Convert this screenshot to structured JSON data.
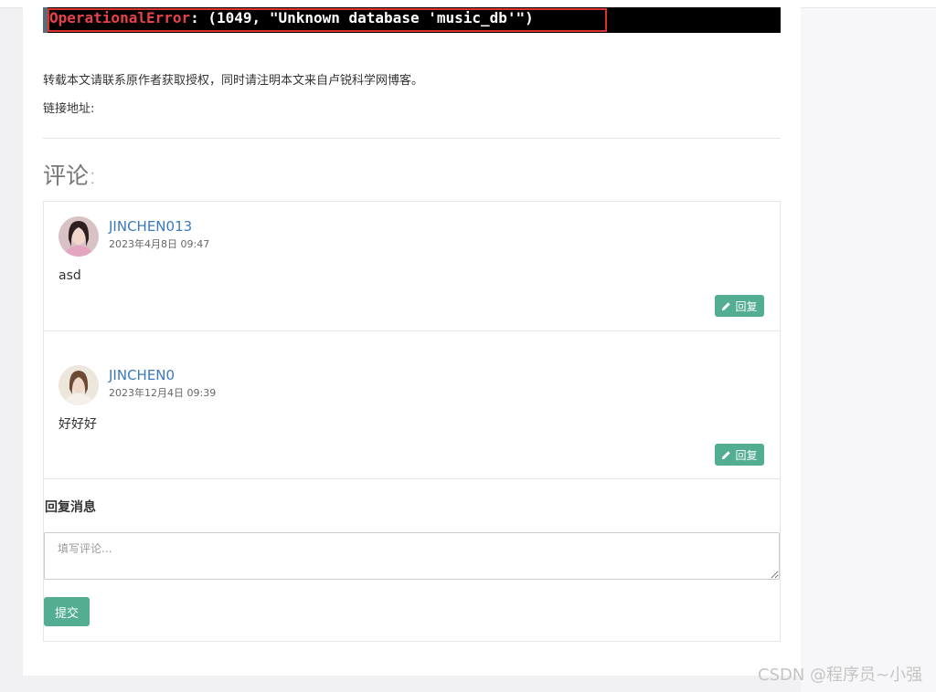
{
  "error_banner": {
    "error_type": "OperationalError",
    "error_message": ": (1049, \"Unknown database 'music_db'\")"
  },
  "article_footer": {
    "copyright_notice": "转载本文请联系原作者获取授权，同时请注明本文来自卢锐科学网博客。",
    "link_label": "链接地址:"
  },
  "comments": {
    "title": "评论:",
    "items": [
      {
        "username": "JINCHEN013",
        "date": "2023年4月8日 09:47",
        "text": "asd",
        "reply_label": "回复"
      },
      {
        "username": "JINCHEN0",
        "date": "2023年12月4日 09:39",
        "text": "好好好",
        "reply_label": "回复"
      }
    ]
  },
  "reply_form": {
    "heading": "回复消息",
    "placeholder": "填写评论...",
    "submit_label": "提交"
  },
  "watermark": "CSDN @程序员~小强",
  "colors": {
    "accent_button": "#52ad91",
    "username_link": "#3a7ab8",
    "error_red": "#e8414b",
    "highlight_border": "#d9342b"
  }
}
